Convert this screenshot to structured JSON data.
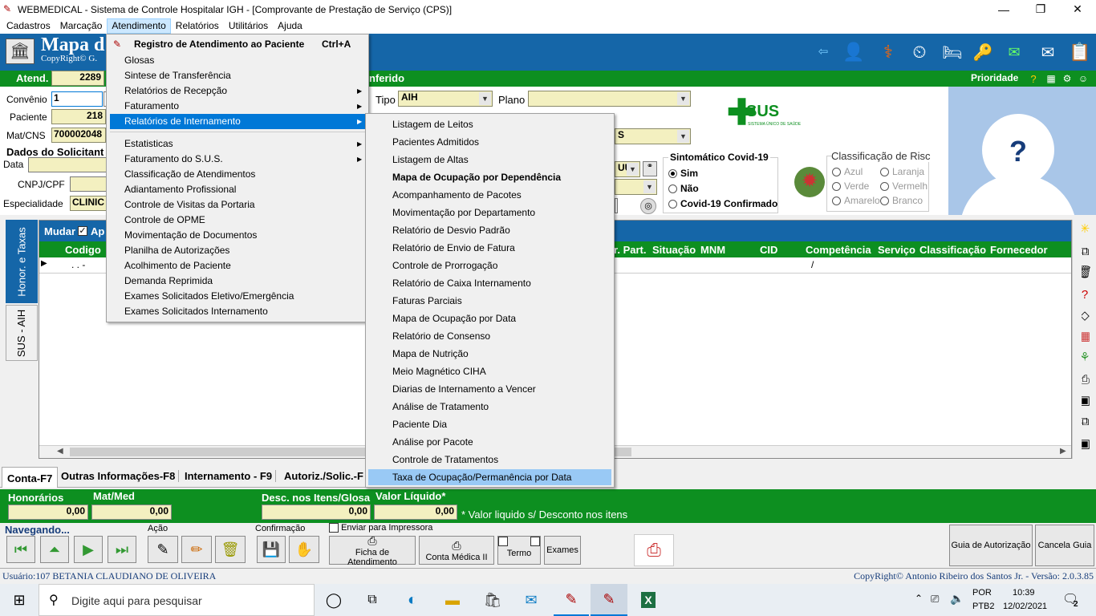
{
  "window": {
    "title": "WEBMEDICAL - Sistema de Controle Hospitalar IGH - [Comprovante de Prestação de Serviço  (CPS)]",
    "min": "—",
    "max": "❐",
    "close": "✕"
  },
  "menubar": [
    "Cadastros",
    "Marcação",
    "Atendimento",
    "Relatórios",
    "Utilitários",
    "Ajuda"
  ],
  "banner": {
    "title": "Mapa d",
    "copyright": "CopyRight© G."
  },
  "row1": {
    "atend_label": "Atend.",
    "atend_value": "2289",
    "conferido": "nferido",
    "prioridade": "Prioridade"
  },
  "form": {
    "convenio_label": "Convênio",
    "convenio_value": "1",
    "paciente_label": "Paciente",
    "paciente_value": "218",
    "matcns_label": "Mat/CNS",
    "matcns_value": "700002048",
    "dados_label": "Dados do Solicitant",
    "data_label": "Data",
    "cnpj_label": "CNPJ/CPF",
    "especialidade_label": "Especialidade",
    "especialidade_value": "CLINIC",
    "tipo_label": "Tipo",
    "tipo_value": "AIH",
    "plano_label": "Plano",
    "plano_value": "",
    "os_value": "S",
    "uu_value": "UU"
  },
  "covid": {
    "title": "Sintomático Covid-19",
    "options": [
      "Sim",
      "Não",
      "Covid-19 Confirmado"
    ],
    "selected": "Sim"
  },
  "risco": {
    "title": "Classificação de Risc",
    "options": [
      "Azul",
      "Laranja",
      "Verde",
      "Vermelh",
      "Amarelo",
      "Branco"
    ]
  },
  "sus_logo": "SUS",
  "sus_sub": "SISTEMA ÚNICO DE SAÚDE",
  "photo_placeholder": "?",
  "side_tabs": [
    "Honor. e Taxas",
    "SUS - AIH"
  ],
  "grid": {
    "mudar_label": "Mudar",
    "ap_label": "Ap",
    "codigo_header": "Codigo",
    "columns": [
      "r. Part.",
      "Situação",
      "MNM",
      "CID",
      "Competência",
      "Serviço",
      "Classificação",
      "Fornecedor"
    ],
    "row_dots": ". .  -",
    "comp_value": "/"
  },
  "bottom_tabs": [
    "Conta-F7",
    "Outras Informações-F8",
    "Internamento - F9",
    "Autoriz./Solic.-F"
  ],
  "totals": {
    "honorarios_label": "Honorários",
    "honorarios_value": "0,00",
    "matmed_label": "Mat/Med",
    "matmed_value": "0,00",
    "desc_label": "Desc. nos Itens/Glosa",
    "desc_value": "0,00",
    "liquido_label": "Valor Líquido*",
    "liquido_value": "0,00",
    "note": "* Valor liquido s/ Desconto nos itens"
  },
  "toolbar": {
    "navegando": "Navegando...",
    "acao": "Ação",
    "confirmacao": "Confirmação",
    "enviar": "Enviar para Impressora",
    "ficha": "Ficha de Atendimento",
    "conta": "Conta Médica II",
    "termo": "Termo",
    "exames": "Exames",
    "guia": "Guia de Autorização",
    "cancela": "Cancela Guia"
  },
  "status": {
    "user": "Usuário:107 BETANIA CLAUDIANO DE OLIVEIRA",
    "copyright": "CopyRight© Antonio Ribeiro dos Santos Jr. - Versão: 2.0.3.85"
  },
  "atendimento_menu": [
    {
      "label": "Registro de Atendimento ao Paciente",
      "shortcut": "Ctrl+A",
      "bold": true
    },
    {
      "label": "Glosas"
    },
    {
      "label": "Sintese de Transferência"
    },
    {
      "label": "Relatórios de Recepção",
      "arrow": true
    },
    {
      "label": "Faturamento",
      "arrow": true
    },
    {
      "label": "Relatórios de Internamento",
      "arrow": true,
      "hl": true
    },
    {
      "label": "Estatisticas",
      "arrow": true
    },
    {
      "label": "Faturamento do S.U.S.",
      "arrow": true
    },
    {
      "label": "Classificação de Atendimentos"
    },
    {
      "label": "Adiantamento Profissional"
    },
    {
      "label": "Controle de Visitas da Portaria"
    },
    {
      "label": "Controle de OPME"
    },
    {
      "label": "Movimentação de Documentos"
    },
    {
      "label": "Planilha de Autorizações"
    },
    {
      "label": "Acolhimento de Paciente"
    },
    {
      "label": "Demanda Reprimida"
    },
    {
      "label": "Exames Solicitados Eletivo/Emergência"
    },
    {
      "label": "Exames Solicitados Internamento"
    }
  ],
  "internamento_submenu": [
    "Listagem de Leitos",
    "Pacientes Admitidos",
    "Listagem de Altas",
    "Mapa de Ocupação por Dependência",
    "Acompanhamento de Pacotes",
    "Movimentação por Departamento",
    "Relatório de Desvio Padrão",
    "Relatório de Envio de Fatura",
    "Controle de Prorrogação",
    "Relatório de Caixa Internamento",
    "Faturas Parciais",
    "Mapa de Ocupação por Data",
    "Relatório de Consenso",
    "Mapa de Nutrição",
    "Meio Magnético CIHA",
    "Diarias de Internamento a Vencer",
    "Análise de Tratamento",
    "Paciente Dia",
    "Análise por Pacote",
    "Controle de Tratamentos",
    "Taxa de Ocupação/Permanência  por Data"
  ],
  "taskbar": {
    "search": "Digite aqui para pesquisar",
    "lang1": "POR",
    "lang2": "PTB2",
    "time": "10:39",
    "date": "12/02/2021",
    "notif": "2"
  }
}
